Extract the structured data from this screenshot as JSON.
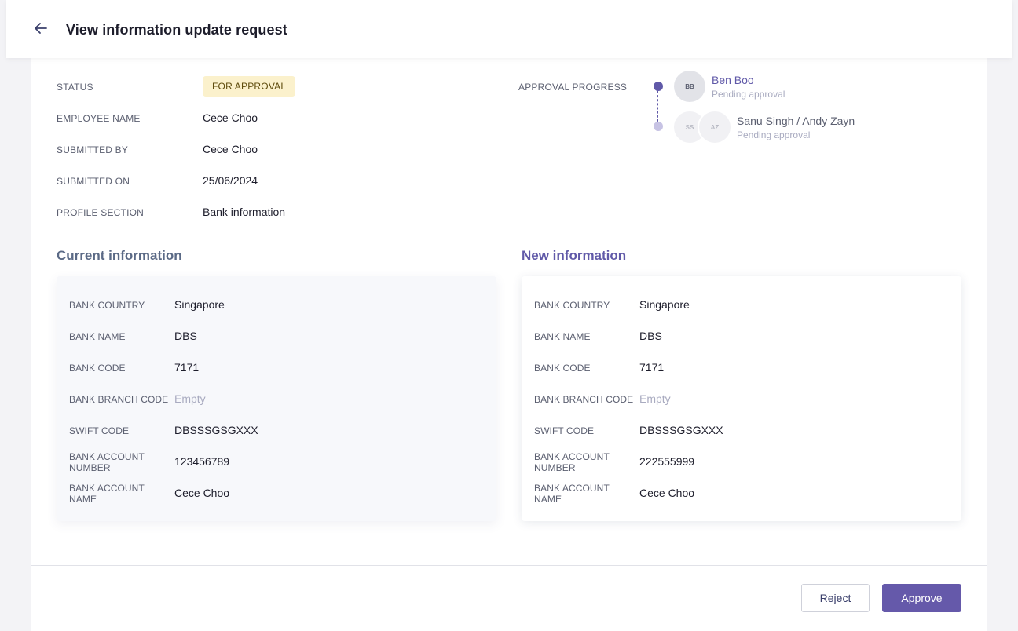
{
  "header": {
    "title": "View information update request",
    "back_icon": "arrow-left-icon"
  },
  "details": {
    "status_label": "STATUS",
    "status_value": "FOR APPROVAL",
    "employee_name_label": "EMPLOYEE NAME",
    "employee_name_value": "Cece Choo",
    "submitted_by_label": "SUBMITTED BY",
    "submitted_by_value": "Cece Choo",
    "submitted_on_label": "SUBMITTED ON",
    "submitted_on_value": "25/06/2024",
    "profile_section_label": "PROFILE SECTION",
    "profile_section_value": "Bank information"
  },
  "approval": {
    "label": "APPROVAL PROGRESS",
    "steps": [
      {
        "initials": [
          "BB"
        ],
        "name": "Ben Boo",
        "status": "Pending approval",
        "active": true
      },
      {
        "initials": [
          "SS",
          "AZ"
        ],
        "name": "Sanu Singh / Andy Zayn",
        "status": "Pending approval",
        "active": false
      }
    ]
  },
  "current": {
    "title": "Current information",
    "rows": [
      {
        "label": "BANK COUNTRY",
        "value": "Singapore"
      },
      {
        "label": "BANK NAME",
        "value": "DBS"
      },
      {
        "label": "BANK CODE",
        "value": "7171"
      },
      {
        "label": "BANK BRANCH CODE",
        "value": "Empty"
      },
      {
        "label": "SWIFT CODE",
        "value": "DBSSSGSGXXX"
      },
      {
        "label": "BANK ACCOUNT NUMBER",
        "value": "123456789"
      },
      {
        "label": "BANK ACCOUNT NAME",
        "value": "Cece Choo"
      }
    ]
  },
  "new": {
    "title": "New information",
    "rows": [
      {
        "label": "BANK COUNTRY",
        "value": "Singapore"
      },
      {
        "label": "BANK NAME",
        "value": "DBS"
      },
      {
        "label": "BANK CODE",
        "value": "7171"
      },
      {
        "label": "BANK BRANCH CODE",
        "value": "Empty"
      },
      {
        "label": "SWIFT CODE",
        "value": "DBSSSGSGXXX"
      },
      {
        "label": "BANK ACCOUNT NUMBER",
        "value": "222555999"
      },
      {
        "label": "BANK ACCOUNT NAME",
        "value": "Cece Choo"
      }
    ]
  },
  "actions": {
    "reject_label": "Reject",
    "approve_label": "Approve"
  },
  "colors": {
    "accent": "#6559aa",
    "current_title": "#5b6a86",
    "new_title": "#6059a8",
    "badge_bg": "#fbf1cc"
  }
}
